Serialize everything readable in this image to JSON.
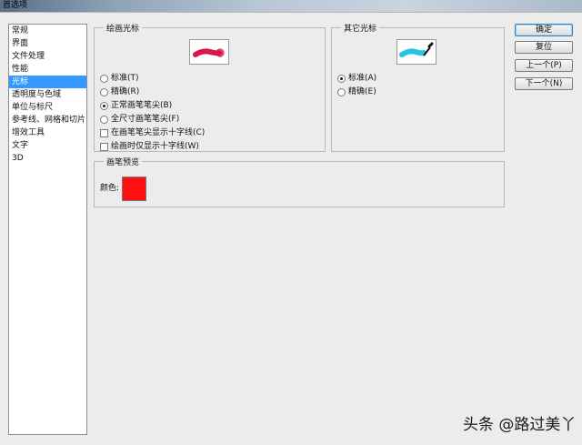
{
  "window": {
    "title": "首选项"
  },
  "sidebar": {
    "items": [
      {
        "label": "常规"
      },
      {
        "label": "界面"
      },
      {
        "label": "文件处理"
      },
      {
        "label": "性能"
      },
      {
        "label": "光标"
      },
      {
        "label": "透明度与色域"
      },
      {
        "label": "单位与标尺"
      },
      {
        "label": "参考线、网格和切片"
      },
      {
        "label": "增效工具"
      },
      {
        "label": "文字"
      },
      {
        "label": "3D"
      }
    ],
    "selected": "光标"
  },
  "painting_cursors": {
    "legend": "绘画光标",
    "brush_color": "#d8174a",
    "options": [
      {
        "label": "标准(T)",
        "checked": false
      },
      {
        "label": "精确(R)",
        "checked": false
      },
      {
        "label": "正常画笔笔尖(B)",
        "checked": true
      },
      {
        "label": "全尺寸画笔笔尖(F)",
        "checked": false
      }
    ],
    "checkboxes": [
      {
        "label": "在画笔笔尖显示十字线(C)",
        "checked": false
      },
      {
        "label": "绘画时仅显示十字线(W)",
        "checked": false
      }
    ]
  },
  "other_cursors": {
    "legend": "其它光标",
    "brush_color": "#29c3e3",
    "options": [
      {
        "label": "标准(A)",
        "checked": true
      },
      {
        "label": "精确(E)",
        "checked": false
      }
    ]
  },
  "brush_preview": {
    "legend": "画笔预览",
    "color_label": "颜色:",
    "color": "#ff1010"
  },
  "buttons": {
    "ok": "确定",
    "reset": "复位",
    "prev": "上一个(P)",
    "next": "下一个(N)"
  },
  "watermark": "头条 @路过美丫"
}
